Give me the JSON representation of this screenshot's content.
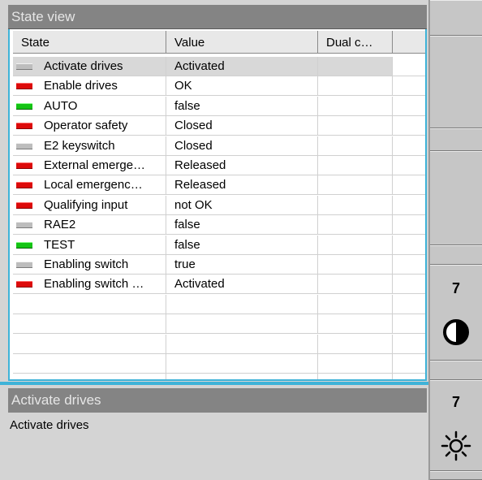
{
  "state_view": {
    "title": "State view",
    "columns": [
      "State",
      "Value",
      "Dual c…"
    ],
    "rows": [
      {
        "indicator": "gray",
        "state": "Activate drives",
        "value": "Activated",
        "selected": true
      },
      {
        "indicator": "red",
        "state": "Enable drives",
        "value": "OK"
      },
      {
        "indicator": "green",
        "state": "AUTO",
        "value": "false"
      },
      {
        "indicator": "red",
        "state": "Operator safety",
        "value": "Closed"
      },
      {
        "indicator": "gray",
        "state": "E2 keyswitch",
        "value": "Closed"
      },
      {
        "indicator": "red",
        "state": "External emerge…",
        "value": "Released"
      },
      {
        "indicator": "red",
        "state": "Local emergenc…",
        "value": "Released"
      },
      {
        "indicator": "red",
        "state": "Qualifying input",
        "value": "not OK"
      },
      {
        "indicator": "gray",
        "state": "RAE2",
        "value": "false"
      },
      {
        "indicator": "green",
        "state": "TEST",
        "value": "false"
      },
      {
        "indicator": "gray",
        "state": "Enabling switch",
        "value": "true"
      },
      {
        "indicator": "red",
        "state": "Enabling switch …",
        "value": "Activated"
      }
    ],
    "empty_rows": 5
  },
  "detail": {
    "title": "Activate drives",
    "description": "Activate drives"
  },
  "right_bar": {
    "contrast_value": "7",
    "contrast_icon": "contrast-icon",
    "brightness_value": "7",
    "brightness_icon": "brightness-icon"
  },
  "colors": {
    "title_bar": "#848484",
    "accent": "#3fb3d8",
    "led_red": "#dd0a0a",
    "led_green": "#14c414",
    "led_gray": "#bdbdbd"
  }
}
